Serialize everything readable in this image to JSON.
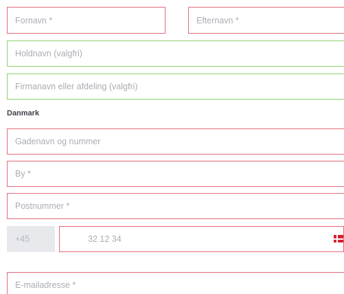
{
  "fields": {
    "first_name": {
      "placeholder": "Fornavn *"
    },
    "last_name": {
      "placeholder": "Efternavn *"
    },
    "team_name": {
      "placeholder": "Holdnavn (valgfri)"
    },
    "company": {
      "placeholder": "Firmanavn eller afdeling (valgfri)"
    },
    "street": {
      "placeholder": "Gadenavn og nummer"
    },
    "city": {
      "placeholder": "By *"
    },
    "postal_code": {
      "placeholder": "Postnummer *"
    },
    "phone": {
      "prefix": "+45",
      "placeholder": "32 12 34",
      "flag_icon": "denmark-flag-icon"
    },
    "email": {
      "placeholder": "E-mailadresse *"
    }
  },
  "address": {
    "country_label": "Danmark"
  },
  "colors": {
    "required_border": "#e46a78",
    "optional_border": "#8bd16b",
    "placeholder_text": "#a9adb3",
    "prefix_background": "#e7e9ec",
    "label_text": "#3b3f45",
    "flag_red": "#d3222f"
  }
}
